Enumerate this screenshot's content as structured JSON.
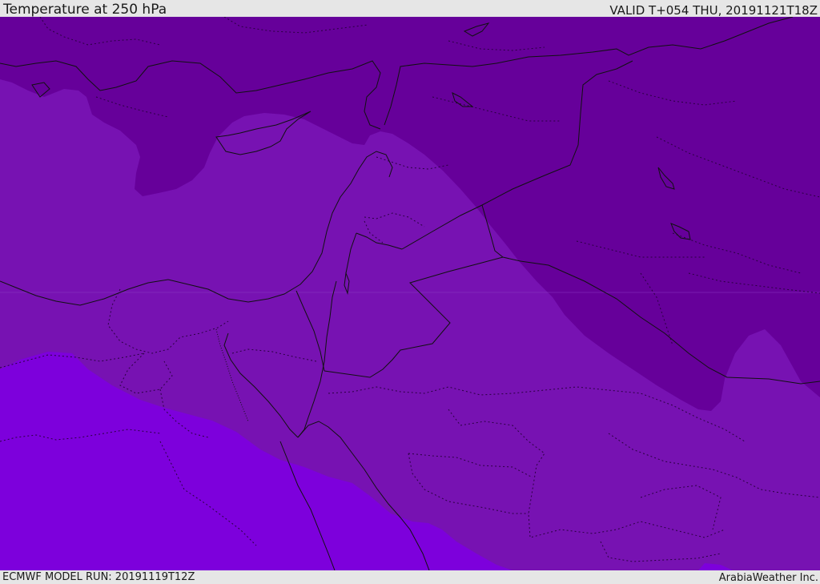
{
  "header": {
    "title": "Temperature at 250 hPa",
    "valid": "VALID T+054 THU, 20191121T18Z"
  },
  "footer": {
    "model_run": "ECMWF MODEL RUN: 20191119T12Z",
    "credit": "ArabiaWeather Inc."
  },
  "colors": {
    "band_cold": "#66009a",
    "band_mid": "#7712b2",
    "band_warm": "#7d00dc",
    "border": "#111111",
    "bar_bg": "#e6e6e6"
  }
}
